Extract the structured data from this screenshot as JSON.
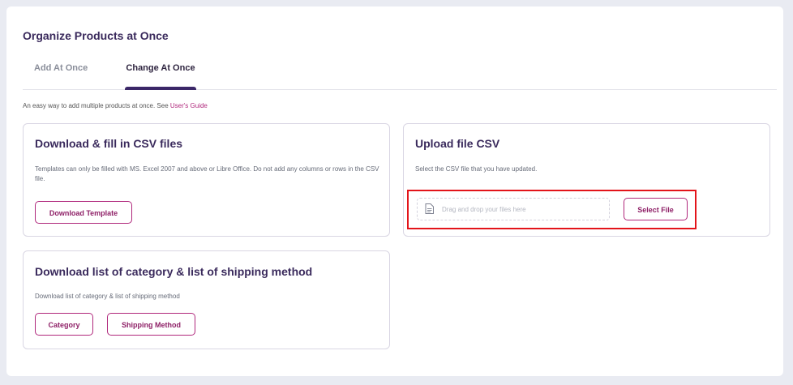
{
  "page": {
    "title": "Organize Products at Once"
  },
  "tabs": [
    {
      "label": "Add At Once",
      "active": false
    },
    {
      "label": "Change At Once",
      "active": true
    }
  ],
  "intro": {
    "text": "An easy way to add multiple products at once. See ",
    "link": "User's Guide"
  },
  "download_card": {
    "title": "Download & fill in CSV files",
    "description": "Templates can only be filled with MS. Excel 2007 and above or Libre Office. Do not add any columns or rows in the CSV file.",
    "button": "Download Template"
  },
  "upload_card": {
    "title": "Upload file CSV",
    "description": "Select the CSV file that you have updated.",
    "dropzone_placeholder": "Drag and drop your files here",
    "button": "Select File"
  },
  "lists_card": {
    "title": "Download list of category & list of shipping method",
    "description": "Download list of category & list of shipping method",
    "category_button": "Category",
    "shipping_button": "Shipping Method"
  },
  "colors": {
    "accent": "#b0287c",
    "heading": "#3a2a5c",
    "highlight": "#e3141a"
  }
}
